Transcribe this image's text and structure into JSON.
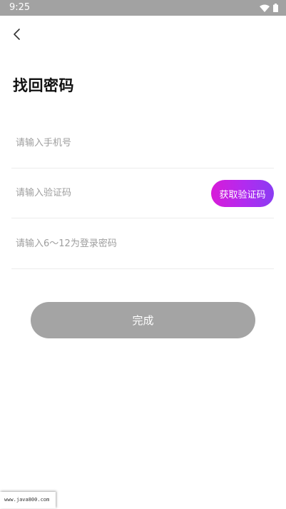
{
  "status_bar": {
    "time": "9:25",
    "icons": [
      "wifi-icon",
      "battery-icon"
    ]
  },
  "header": {
    "back_icon": "chevron-left-icon"
  },
  "page": {
    "title": "找回密码"
  },
  "form": {
    "phone": {
      "placeholder": "请输入手机号",
      "value": ""
    },
    "code": {
      "placeholder": "请输入验证码",
      "value": "",
      "get_code_label": "获取验证码"
    },
    "password": {
      "placeholder": "请输入6～12为登录密码",
      "value": ""
    },
    "submit_label": "完成"
  },
  "watermark": {
    "text": "www.java800.com"
  },
  "colors": {
    "status_bar": "#a2a2a2",
    "get_code_gradient_start": "#d81bd8",
    "get_code_gradient_end": "#8a3cf2",
    "submit_disabled": "#a4a4a4",
    "divider": "#ececec",
    "placeholder": "#9e9e9e"
  }
}
